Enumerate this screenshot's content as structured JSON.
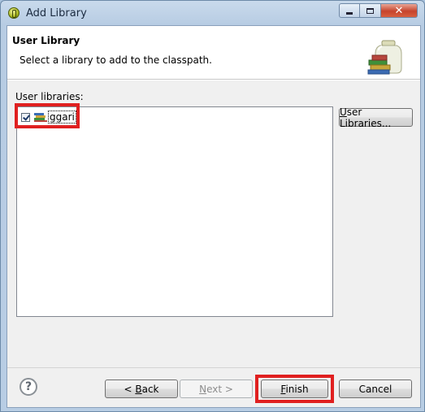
{
  "window": {
    "title": "Add Library",
    "controls": {
      "minimize": "minimize",
      "maximize": "maximize",
      "close": "✕"
    }
  },
  "banner": {
    "title": "User Library",
    "message": "Select a library to add to the classpath."
  },
  "libraries": {
    "label": "User libraries:",
    "items": [
      {
        "name": "ggari",
        "checked": true
      }
    ]
  },
  "buttons": {
    "user_libraries": {
      "mnemonic": "U",
      "rest": "ser Libraries..."
    },
    "back": {
      "prefix": "< ",
      "mnemonic": "B",
      "rest": "ack"
    },
    "next": {
      "mnemonic": "N",
      "rest": "ext >"
    },
    "finish": {
      "mnemonic": "F",
      "rest": "inish"
    },
    "cancel": "Cancel"
  },
  "help": "?",
  "colors": {
    "highlight": "#e02020",
    "close": "#c6442c"
  }
}
